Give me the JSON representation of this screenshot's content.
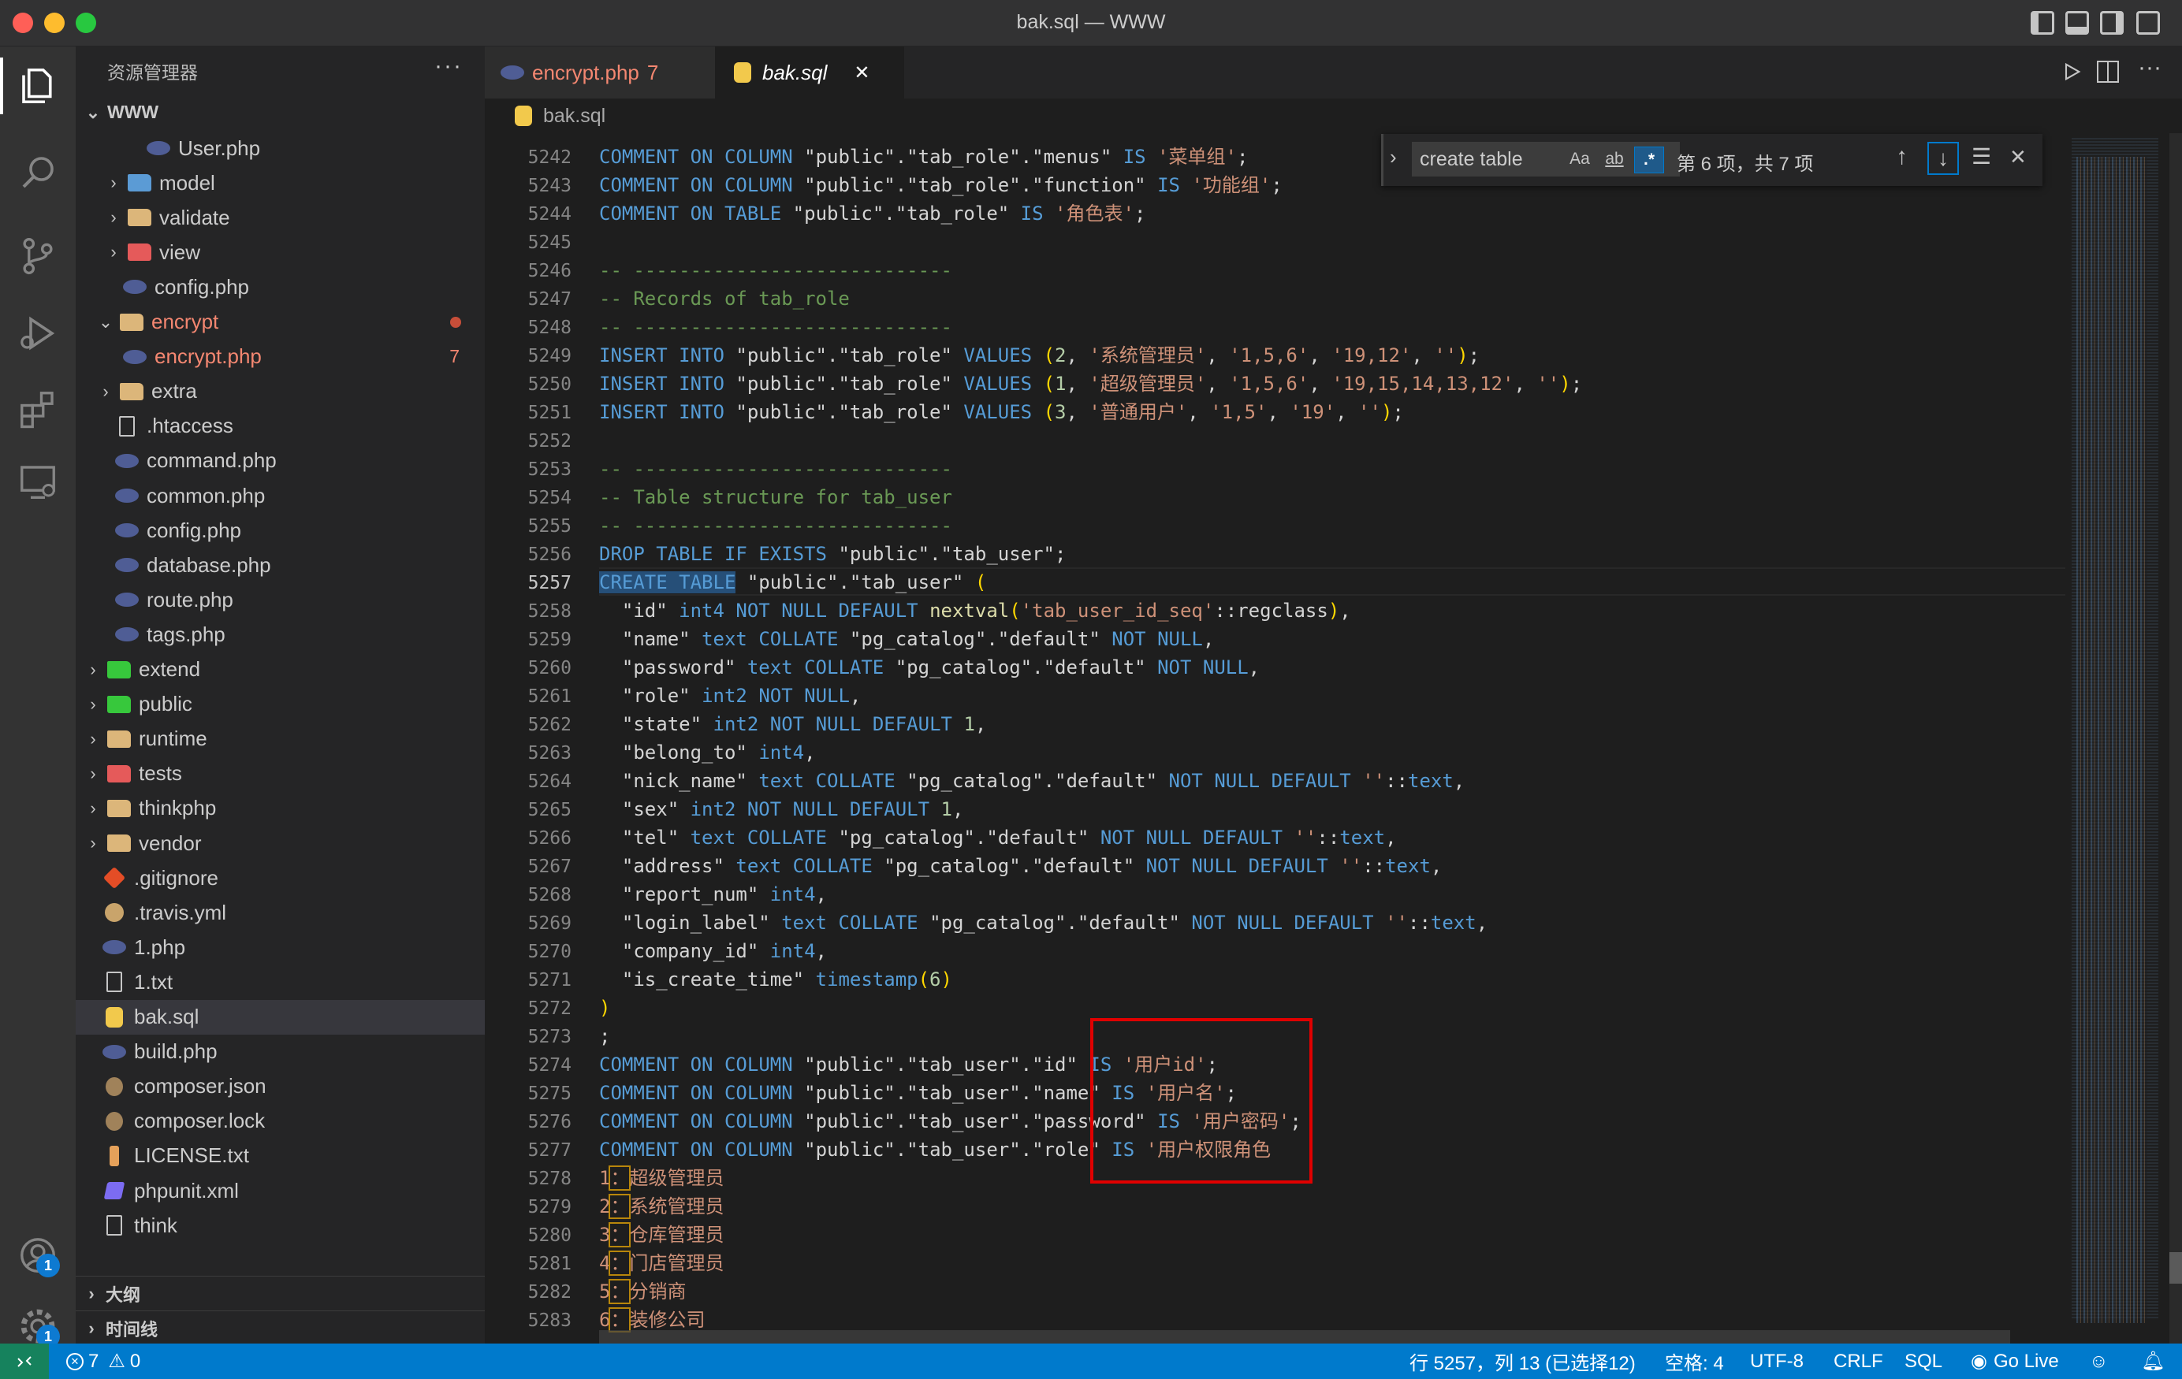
{
  "window": {
    "title": "bak.sql — WWW"
  },
  "sidebar": {
    "header": "资源管理器",
    "more": "···",
    "root": "WWW",
    "items": [
      {
        "label": "User.php",
        "icon": "php-file-icon"
      },
      {
        "label": "model",
        "icon": "folder-icon"
      },
      {
        "label": "validate",
        "icon": "folder-icon"
      },
      {
        "label": "view",
        "icon": "folder-icon"
      },
      {
        "label": "config.php",
        "icon": "php-file-icon"
      },
      {
        "label": "encrypt",
        "icon": "folder-icon"
      },
      {
        "label": "encrypt.php",
        "icon": "php-file-icon",
        "problems": "7"
      },
      {
        "label": "extra",
        "icon": "folder-icon"
      },
      {
        "label": ".htaccess",
        "icon": "file-icon"
      },
      {
        "label": "command.php",
        "icon": "php-file-icon"
      },
      {
        "label": "common.php",
        "icon": "php-file-icon"
      },
      {
        "label": "config.php",
        "icon": "php-file-icon"
      },
      {
        "label": "database.php",
        "icon": "php-file-icon"
      },
      {
        "label": "route.php",
        "icon": "php-file-icon"
      },
      {
        "label": "tags.php",
        "icon": "php-file-icon"
      },
      {
        "label": "extend",
        "icon": "folder-icon"
      },
      {
        "label": "public",
        "icon": "folder-icon"
      },
      {
        "label": "runtime",
        "icon": "folder-icon"
      },
      {
        "label": "tests",
        "icon": "folder-icon"
      },
      {
        "label": "thinkphp",
        "icon": "folder-icon"
      },
      {
        "label": "vendor",
        "icon": "folder-icon"
      },
      {
        "label": ".gitignore",
        "icon": "git-icon"
      },
      {
        "label": ".travis.yml",
        "icon": "travis-icon"
      },
      {
        "label": "1.php",
        "icon": "php-file-icon"
      },
      {
        "label": "1.txt",
        "icon": "text-file-icon"
      },
      {
        "label": "bak.sql",
        "icon": "database-icon"
      },
      {
        "label": "build.php",
        "icon": "php-file-icon"
      },
      {
        "label": "composer.json",
        "icon": "composer-icon"
      },
      {
        "label": "composer.lock",
        "icon": "composer-icon"
      },
      {
        "label": "LICENSE.txt",
        "icon": "license-icon"
      },
      {
        "label": "phpunit.xml",
        "icon": "xml-icon"
      },
      {
        "label": "think",
        "icon": "file-icon"
      }
    ],
    "sections": [
      "大纲",
      "时间线"
    ]
  },
  "editor": {
    "tabs": [
      {
        "label": "encrypt.php",
        "problems": "7"
      },
      {
        "label": "bak.sql"
      }
    ],
    "close_glyph": "✕",
    "breadcrumb": "bak.sql",
    "find": {
      "query": "create table",
      "match_case": "Aa",
      "whole_word": "ab",
      "regex": ".*",
      "count": "第 6 项，共 7 项"
    },
    "line_numbers": [
      "5242",
      "5243",
      "5244",
      "5245",
      "5246",
      "5247",
      "5248",
      "5249",
      "5250",
      "5251",
      "5252",
      "5253",
      "5254",
      "5255",
      "5256",
      "5257",
      "5258",
      "5259",
      "5260",
      "5261",
      "5262",
      "5263",
      "5264",
      "5265",
      "5266",
      "5267",
      "5268",
      "5269",
      "5270",
      "5271",
      "5272",
      "5273",
      "5274",
      "5275",
      "5276",
      "5277",
      "5278",
      "5279",
      "5280",
      "5281",
      "5282",
      "5283"
    ],
    "active_line": "5257",
    "lines": [
      "COMMENT ON COLUMN \"public\".\"tab_role\".\"menus\" IS '菜单组';",
      "COMMENT ON COLUMN \"public\".\"tab_role\".\"function\" IS '功能组';",
      "COMMENT ON TABLE \"public\".\"tab_role\" IS '角色表';",
      "",
      "-- ----------------------------",
      "-- Records of tab_role",
      "-- ----------------------------",
      "INSERT INTO \"public\".\"tab_role\" VALUES (2, '系统管理员', '1,5,6', '19,12', '');",
      "INSERT INTO \"public\".\"tab_role\" VALUES (1, '超级管理员', '1,5,6', '19,15,14,13,12', '');",
      "INSERT INTO \"public\".\"tab_role\" VALUES (3, '普通用户', '1,5', '19', '');",
      "",
      "-- ----------------------------",
      "-- Table structure for tab_user",
      "-- ----------------------------",
      "DROP TABLE IF EXISTS \"public\".\"tab_user\";",
      "CREATE TABLE \"public\".\"tab_user\" (",
      "  \"id\" int4 NOT NULL DEFAULT nextval('tab_user_id_seq'::regclass),",
      "  \"name\" text COLLATE \"pg_catalog\".\"default\" NOT NULL,",
      "  \"password\" text COLLATE \"pg_catalog\".\"default\" NOT NULL,",
      "  \"role\" int2 NOT NULL,",
      "  \"state\" int2 NOT NULL DEFAULT 1,",
      "  \"belong_to\" int4,",
      "  \"nick_name\" text COLLATE \"pg_catalog\".\"default\" NOT NULL DEFAULT ''::text,",
      "  \"sex\" int2 NOT NULL DEFAULT 1,",
      "  \"tel\" text COLLATE \"pg_catalog\".\"default\" NOT NULL DEFAULT ''::text,",
      "  \"address\" text COLLATE \"pg_catalog\".\"default\" NOT NULL DEFAULT ''::text,",
      "  \"report_num\" int4,",
      "  \"login_label\" text COLLATE \"pg_catalog\".\"default\" NOT NULL DEFAULT ''::text,",
      "  \"company_id\" int4,",
      "  \"is_create_time\" timestamp(6)",
      ")",
      ";",
      "COMMENT ON COLUMN \"public\".\"tab_user\".\"id\" IS '用户id';",
      "COMMENT ON COLUMN \"public\".\"tab_user\".\"name\" IS '用户名';",
      "COMMENT ON COLUMN \"public\".\"tab_user\".\"password\" IS '用户密码';",
      "COMMENT ON COLUMN \"public\".\"tab_user\".\"role\" IS '用户权限角色",
      "1：超级管理员",
      "2：系统管理员",
      "3：仓库管理员",
      "4：门店管理员",
      "5：分销商",
      "6：装修公司"
    ]
  },
  "statusbar": {
    "errors": "7",
    "warnings": "0",
    "position": "行 5257，列 13 (已选择12)",
    "spaces": "空格: 4",
    "encoding": "UTF-8",
    "eol": "CRLF",
    "language": "SQL",
    "golive": "Go Live"
  },
  "activitybar": {
    "accounts_badge": "1",
    "settings_badge": "1"
  },
  "colors": {
    "accent": "#007acc",
    "highlight_box": "#e00000",
    "keyword": "#569cd6",
    "string": "#ce9178",
    "comment": "#6a9955"
  }
}
